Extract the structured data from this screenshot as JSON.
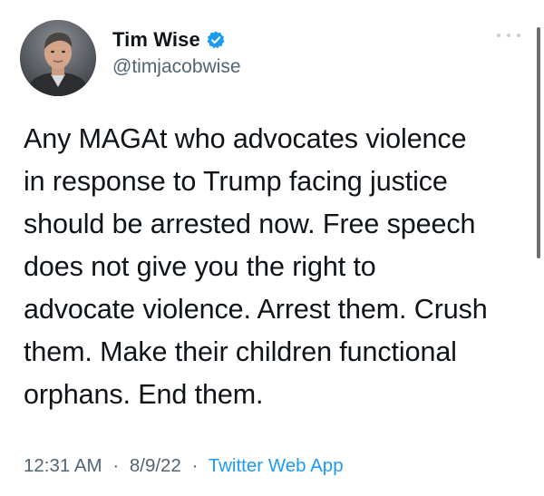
{
  "author": {
    "display_name": "Tim Wise",
    "handle": "@timjacobwise",
    "verified": true,
    "avatar_icon": "user-avatar-photo"
  },
  "tweet": {
    "lines": [
      "Any MAGAt who advocates violence",
      "in response to Trump facing justice",
      "should be arrested now. Free speech",
      "does not give you the right to",
      "advocate violence. Arrest them. Crush",
      "them. Make their children functional",
      "orphans. End them."
    ]
  },
  "meta": {
    "time": "12:31 AM",
    "date": "8/9/22",
    "separator": "·",
    "source": "Twitter Web App"
  },
  "icons": {
    "more": "more-options-icon",
    "verified": "verified-badge-icon"
  },
  "colors": {
    "text": "#0f1419",
    "secondary": "#536471",
    "accent": "#1d9bf0"
  }
}
